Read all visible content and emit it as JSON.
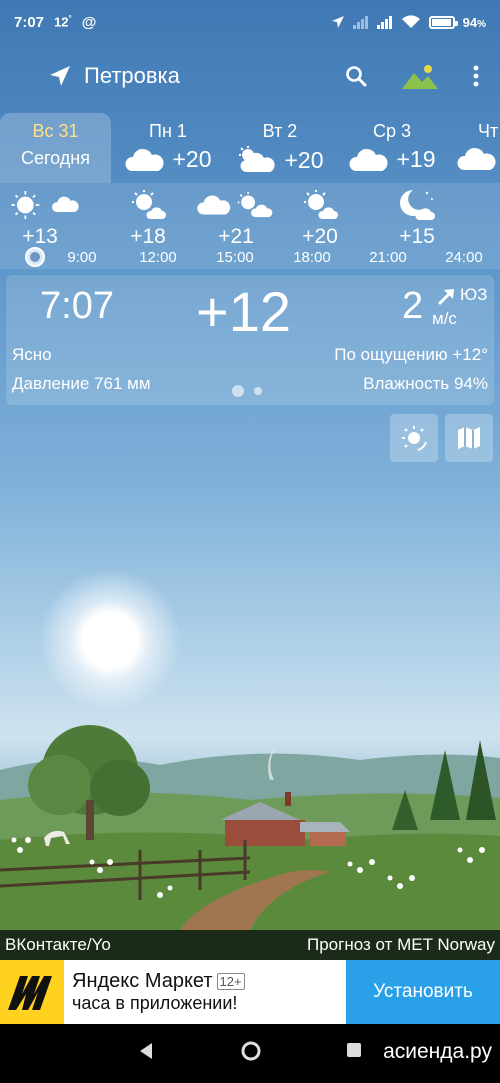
{
  "status_bar": {
    "time": "7:07",
    "weather_temp": "12",
    "at_sign": "@",
    "battery": "94"
  },
  "app_bar": {
    "location": "Петровка",
    "icons": [
      "location-arrow-icon",
      "search-icon",
      "landscape-icon",
      "more-vert-icon"
    ],
    "accent_color": "#e8d94a"
  },
  "days": [
    {
      "name": "Вс 31",
      "sub": "Сегодня",
      "selected": true
    },
    {
      "name": "Пн 1",
      "temp": "+20",
      "icon": "cloud-icon"
    },
    {
      "name": "Вт 2",
      "temp": "+20",
      "icon": "sun-cloud-icon"
    },
    {
      "name": "Ср 3",
      "temp": "+19",
      "icon": "cloud-icon"
    },
    {
      "name": "Чт",
      "icon": "cloud-icon"
    }
  ],
  "hourly": [
    {
      "temp": "+13",
      "time": "9:00",
      "icon": "sun-icon"
    },
    {
      "temp": "+18",
      "time": "12:00",
      "icon": "sun-cloud-icon"
    },
    {
      "temp": "+21",
      "time": "15:00",
      "icon": "sun-cloud-icon"
    },
    {
      "temp": "+20",
      "time": "18:00",
      "icon": "sun-cloud-icon"
    },
    {
      "temp": "+15",
      "time": "21:00",
      "icon": "moon-cloud-icon"
    },
    {
      "time": "24:00"
    }
  ],
  "current": {
    "time": "7:07",
    "temp": "+12",
    "wind_speed": "2",
    "wind_dir": "ЮЗ",
    "wind_unit": "м/с",
    "condition": "Ясно",
    "feels_like": "По ощущению +12°",
    "pressure": "Давление 761 мм",
    "humidity": "Влажность 94%"
  },
  "credits": {
    "left": "ВКонтакте/Yo",
    "right": "Прогноз от MET Norway"
  },
  "ad": {
    "title": "Яндекс Маркет",
    "age": "12+",
    "subtitle": "часа в приложении!",
    "button": "Установить"
  },
  "watermark": "асиенда.ру"
}
